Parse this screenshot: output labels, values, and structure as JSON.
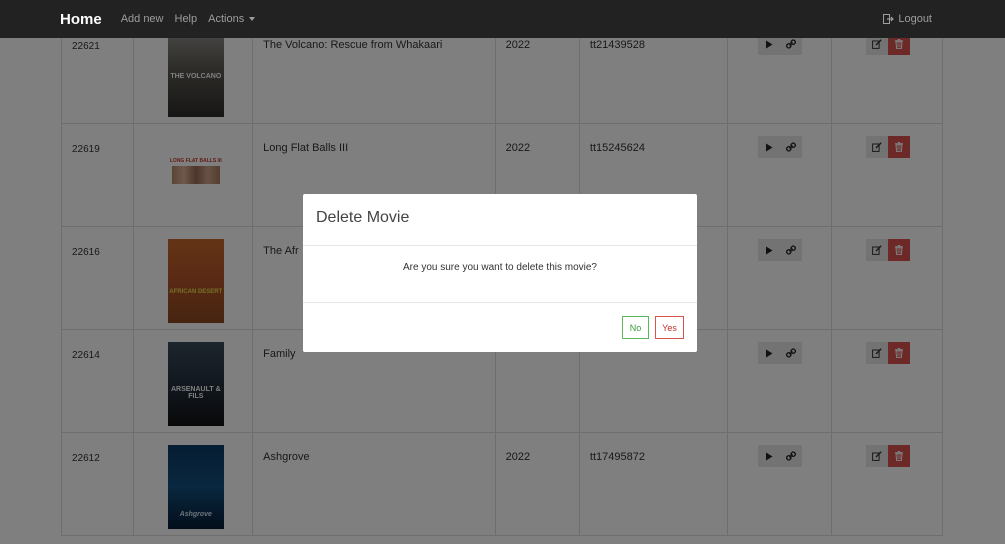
{
  "navbar": {
    "brand": "Home",
    "add_new": "Add new",
    "help": "Help",
    "actions": "Actions",
    "logout": "Logout"
  },
  "movies": [
    {
      "id": "22621",
      "title": "The Volcano: Rescue from Whakaari",
      "year": "2022",
      "imdb": "tt21439528",
      "poster_text": "THE VOLCANO"
    },
    {
      "id": "22619",
      "title": "Long Flat Balls III",
      "year": "2022",
      "imdb": "tt15245624",
      "poster_text": "LONG FLAT BALLS III"
    },
    {
      "id": "22616",
      "title": "The Afr",
      "year": "",
      "imdb": "",
      "poster_text": "AFRICAN DESERT"
    },
    {
      "id": "22614",
      "title": "Family",
      "year": "",
      "imdb": "",
      "poster_text": "ARSENAULT & FILS"
    },
    {
      "id": "22612",
      "title": "Ashgrove",
      "year": "2022",
      "imdb": "tt17495872",
      "poster_text": "Ashgrove"
    }
  ],
  "modal": {
    "title": "Delete Movie",
    "message": "Are you sure you want to delete this movie?",
    "no_label": "No",
    "yes_label": "Yes"
  },
  "colors": {
    "navbar": "#222222",
    "danger": "#d9534f",
    "success": "#5cb85c"
  }
}
